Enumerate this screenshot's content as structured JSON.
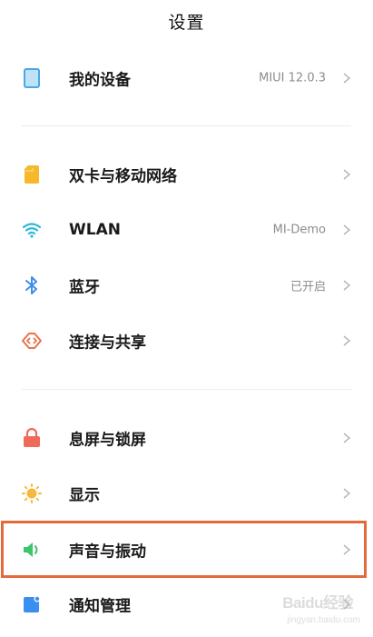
{
  "header": {
    "title": "设置"
  },
  "items": [
    {
      "label": "我的设备",
      "value": "MIUI 12.0.3",
      "icon": "phone-device-icon"
    },
    {
      "label": "双卡与移动网络",
      "value": "",
      "icon": "sim-card-icon"
    },
    {
      "label": "WLAN",
      "value": "MI-Demo",
      "icon": "wifi-icon"
    },
    {
      "label": "蓝牙",
      "value": "已开启",
      "icon": "bluetooth-icon"
    },
    {
      "label": "连接与共享",
      "value": "",
      "icon": "share-connection-icon"
    },
    {
      "label": "息屏与锁屏",
      "value": "",
      "icon": "lock-icon"
    },
    {
      "label": "显示",
      "value": "",
      "icon": "sun-brightness-icon"
    },
    {
      "label": "声音与振动",
      "value": "",
      "icon": "speaker-icon"
    },
    {
      "label": "通知管理",
      "value": "",
      "icon": "notification-icon"
    }
  ],
  "colors": {
    "highlight": "#e46a3b",
    "device_icon": "#4aa8e8",
    "sim_icon": "#f5b92b",
    "wifi_icon": "#2fb8d8",
    "bluetooth_icon": "#3f8ee8",
    "share_icon": "#e8734a",
    "lock_icon": "#f06a5a",
    "sun_icon": "#f6b93b",
    "speaker_icon": "#3ec46d",
    "notification_icon": "#3a8ef0"
  },
  "watermark": {
    "logo": "Baidu经验",
    "url": "jingyan.baidu.com"
  }
}
